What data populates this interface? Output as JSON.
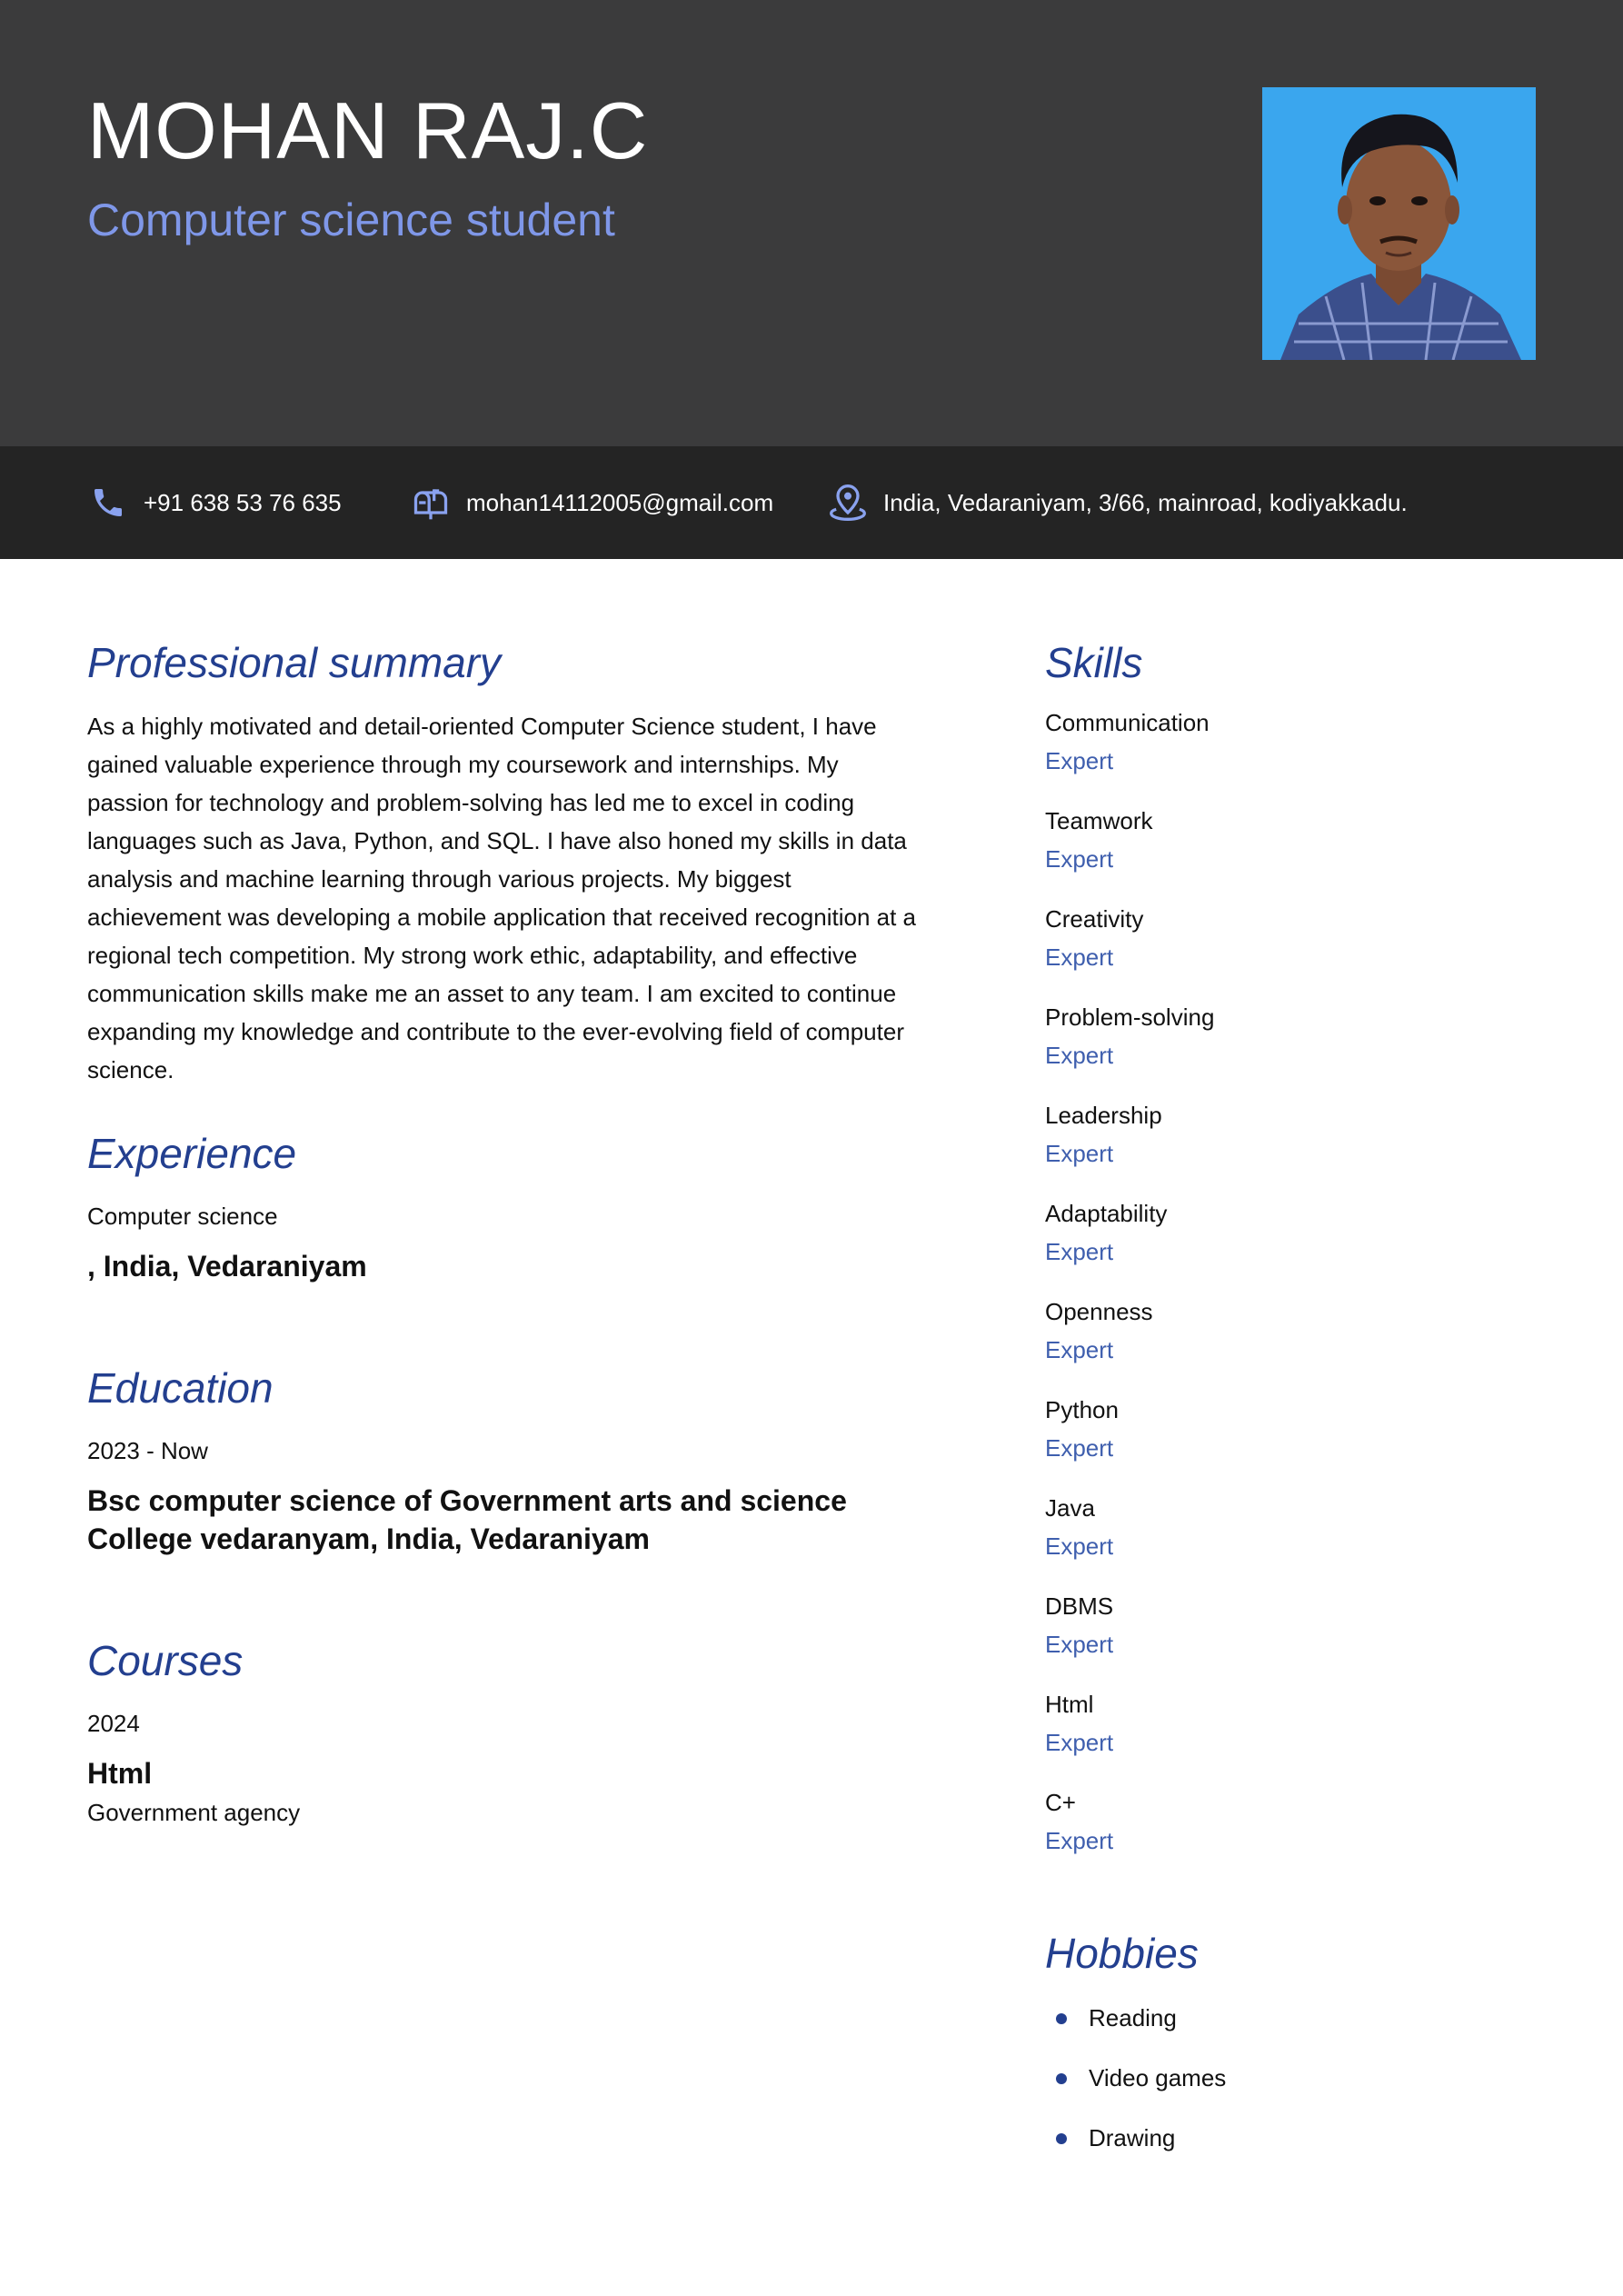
{
  "header": {
    "name": "MOHAN RAJ.C",
    "headline": "Computer science student"
  },
  "contact": {
    "phone": "+91 638 53 76 635",
    "email": "mohan14112005@gmail.com",
    "address": "India, Vedaraniyam, 3/66, mainroad, kodiyakkadu."
  },
  "summary": {
    "title": "Professional summary",
    "text": "As a highly motivated and detail-oriented Computer Science student, I have gained valuable experience through my coursework and internships. My passion for technology and problem-solving has led me to excel in coding languages such as Java, Python, and SQL. I have also honed my skills in data analysis and machine learning through various projects. My biggest achievement was developing a mobile application that received recognition at a regional tech competition. My strong work ethic, adaptability, and effective communication skills make me an asset to any team. I am excited to continue expanding my knowledge and contribute to the ever-evolving field of computer science."
  },
  "experience": {
    "title": "Experience",
    "role": "Computer science",
    "place": ", India, Vedaraniyam"
  },
  "education": {
    "title": "Education",
    "dates": "2023 - Now",
    "degree": "Bsc computer science of Government arts and science College vedaranyam, India, Vedaraniyam"
  },
  "courses": {
    "title": "Courses",
    "year": "2024",
    "name": "Html",
    "org": "Government agency"
  },
  "skills": {
    "title": "Skills",
    "items": [
      {
        "name": "Communication",
        "level": "Expert"
      },
      {
        "name": "Teamwork",
        "level": "Expert"
      },
      {
        "name": "Creativity",
        "level": "Expert"
      },
      {
        "name": "Problem-solving",
        "level": "Expert"
      },
      {
        "name": "Leadership",
        "level": "Expert"
      },
      {
        "name": "Adaptability",
        "level": "Expert"
      },
      {
        "name": "Openness",
        "level": "Expert"
      },
      {
        "name": "Python",
        "level": "Expert"
      },
      {
        "name": "Java",
        "level": "Expert"
      },
      {
        "name": "DBMS",
        "level": "Expert"
      },
      {
        "name": "Html",
        "level": "Expert"
      },
      {
        "name": "C+",
        "level": "Expert"
      }
    ]
  },
  "hobbies": {
    "title": "Hobbies",
    "items": [
      "Reading",
      "Video games",
      "Drawing"
    ]
  },
  "icons": {
    "phone": "phone-icon",
    "email": "mailbox-icon",
    "address": "location-pin-icon"
  },
  "colors": {
    "header_bg": "#3b3b3c",
    "contact_bar_bg": "#242424",
    "accent": "#233f8f",
    "headline": "#7f97e8",
    "icon": "#8aa2ef"
  }
}
